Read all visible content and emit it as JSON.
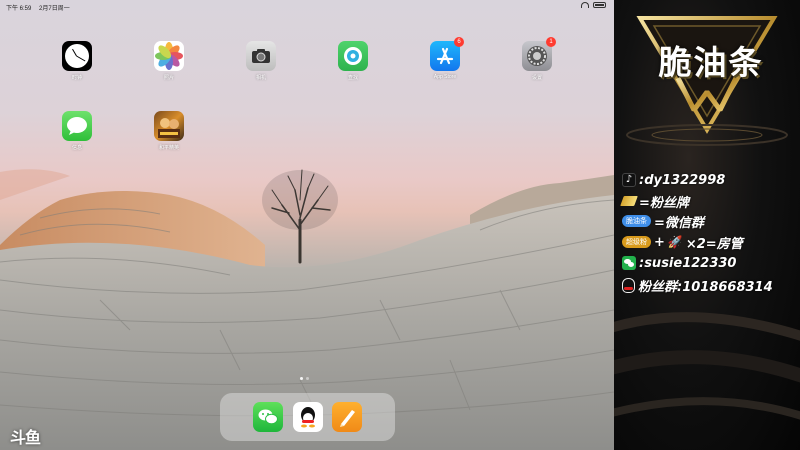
{
  "status_bar": {
    "time": "下午 6:59",
    "date": "2月7日周一"
  },
  "apps": [
    {
      "name": "clock",
      "label": "时钟",
      "badge": ""
    },
    {
      "name": "photos",
      "label": "照片",
      "badge": ""
    },
    {
      "name": "camera",
      "label": "相机",
      "badge": ""
    },
    {
      "name": "find-my",
      "label": "查找",
      "badge": ""
    },
    {
      "name": "app-store",
      "label": "App Store",
      "badge": "6"
    },
    {
      "name": "settings",
      "label": "设置",
      "badge": "1"
    },
    {
      "name": "messages",
      "label": "信息",
      "badge": ""
    },
    {
      "name": "peace-elite",
      "label": "和平精英",
      "badge": ""
    }
  ],
  "dock": [
    {
      "name": "wechat",
      "icon": "wechat-icon"
    },
    {
      "name": "qq",
      "icon": "qq-icon"
    },
    {
      "name": "pages",
      "icon": "pencil-icon"
    }
  ],
  "page_indicator": {
    "pages": 2,
    "current": 1
  },
  "watermark": "斗鱼",
  "panel": {
    "title": "脆油条",
    "rows": {
      "douyin": ":dy1322998",
      "fan_badge": "=粉丝牌",
      "group_chip": "脆油条",
      "wechat_group": "=微信群",
      "gift_chip": "超级粉",
      "plus": "+",
      "gift_suffix": "×2=房管",
      "wechat_id": ":susie122330",
      "fan_group": "粉丝群:1018668314"
    }
  },
  "colors": {
    "badge_red": "#ff3b30",
    "wechat_green": "#22b14c",
    "gold": "#d8b04a",
    "chip_blue": "#3f8ee8",
    "chip_gold": "#d89a1c"
  }
}
